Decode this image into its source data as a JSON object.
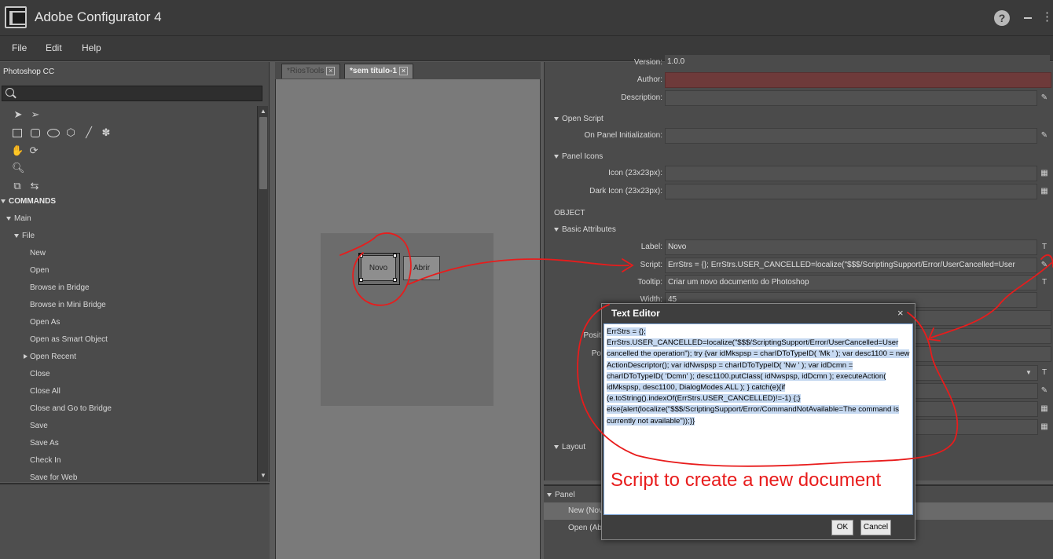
{
  "window": {
    "title": "Adobe Configurator 4",
    "help_glyph": "?"
  },
  "menu": [
    "File",
    "Edit",
    "Help"
  ],
  "left_panel": {
    "title": "Photoshop CC",
    "tree": {
      "commands": "COMMANDS",
      "main": "Main",
      "file": "File",
      "items": [
        "New",
        "Open",
        "Browse in Bridge",
        "Browse in Mini Bridge",
        "Open As",
        "Open as Smart Object",
        "Open Recent",
        "Close",
        "Close All",
        "Close and Go to Bridge",
        "Save",
        "Save As",
        "Check In",
        "Save for Web"
      ]
    }
  },
  "canvas": {
    "tabs": [
      "*RiosTools",
      "*sem título-1"
    ],
    "buttons": {
      "novo": "Novo",
      "abrir": "Abrir"
    }
  },
  "properties": {
    "version": {
      "label": "Version:",
      "value": "1.0.0"
    },
    "author": {
      "label": "Author:",
      "value": ""
    },
    "description": {
      "label": "Description:",
      "value": ""
    },
    "open_script": {
      "title": "Open Script",
      "init_label": "On Panel Initialization:",
      "init_value": ""
    },
    "panel_icons": {
      "title": "Panel Icons",
      "icon_label": "Icon (23x23px):",
      "dark_icon_label": "Dark Icon (23x23px):"
    },
    "object_title": "OBJECT",
    "basic_attributes": {
      "title": "Basic Attributes",
      "label_label": "Label:",
      "label_value": "Novo",
      "script_label": "Script:",
      "script_value": "ErrStrs = {}; ErrStrs.USER_CANCELLED=localize(\"$$$/ScriptingSupport/Error/UserCancelled=User",
      "tooltip_label": "Tooltip:",
      "tooltip_value": "Criar um novo documento do Photoshop",
      "width_label": "Width:",
      "width_value": "45",
      "position_label_partial": "Positi",
      "po_label_partial": "Po"
    },
    "layout_title": "Layout",
    "field_button_t": "T"
  },
  "panel_tree": {
    "title": "Panel",
    "rows": [
      "New (Nov",
      "Open (Ab"
    ]
  },
  "text_editor": {
    "title": "Text Editor",
    "close_glyph": "×",
    "content": "ErrStrs = {}; ErrStrs.USER_CANCELLED=localize(\"$$$/ScriptingSupport/Error/UserCancelled=User cancelled the operation\"); try {var idMkspsp = charIDToTypeID( 'Mk  ' );     var desc1100 = new ActionDescriptor();     var idNwspsp = charIDToTypeID( 'Nw  ' );     var idDcmn = charIDToTypeID( 'Dcmn' );     desc1100.putClass( idNwspsp, idDcmn ); executeAction( idMkspsp, desc1100, DialogModes.ALL ); } catch(e){if (e.toString().indexOf(ErrStrs.USER_CANCELLED)!=-1) {;} else{alert(localize(\"$$$/ScriptingSupport/Error/CommandNotAvailable=The command is currently not available\"));}}",
    "annotation": "Script to create a new document",
    "ok_label": "OK",
    "cancel_label": "Cancel"
  },
  "colors": {
    "annotation_red": "#e81c1c",
    "author_field": "#6e3a3a",
    "selection": "#c6d9f1"
  }
}
